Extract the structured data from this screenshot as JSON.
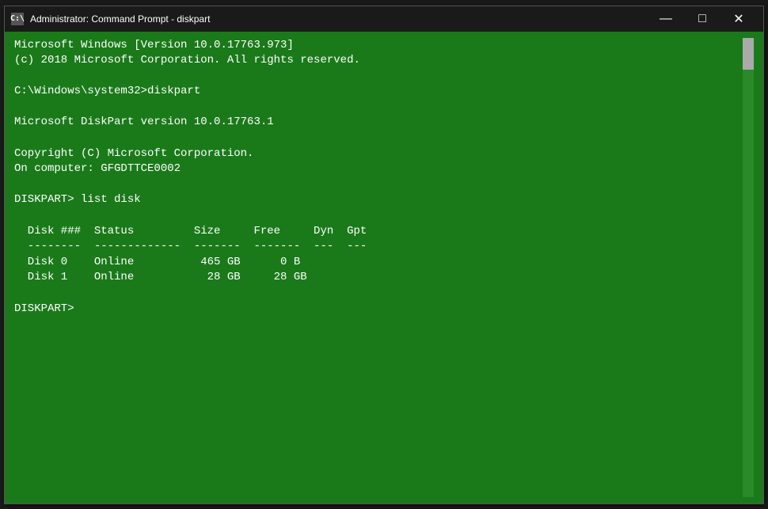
{
  "window": {
    "title": "Administrator: Command Prompt - diskpart",
    "icon_label": "C:"
  },
  "titlebar": {
    "minimize_label": "—",
    "maximize_label": "□",
    "close_label": "✕"
  },
  "terminal": {
    "lines": [
      "Microsoft Windows [Version 10.0.17763.973]",
      "(c) 2018 Microsoft Corporation. All rights reserved.",
      "",
      "C:\\Windows\\system32>diskpart",
      "",
      "Microsoft DiskPart version 10.0.17763.1",
      "",
      "Copyright (C) Microsoft Corporation.",
      "On computer: GFGDTTCE0002",
      "",
      "DISKPART> list disk",
      "",
      "  Disk ###  Status         Size     Free     Dyn  Gpt",
      "  --------  -------------  -------  -------  ---  ---",
      "  Disk 0    Online          465 GB      0 B",
      "  Disk 1    Online           28 GB     28 GB",
      "",
      "DISKPART> "
    ]
  },
  "colors": {
    "terminal_bg": "#1a7a1a",
    "terminal_text": "#ffffff",
    "titlebar_bg": "#1a1a1a",
    "titlebar_text": "#ffffff"
  }
}
